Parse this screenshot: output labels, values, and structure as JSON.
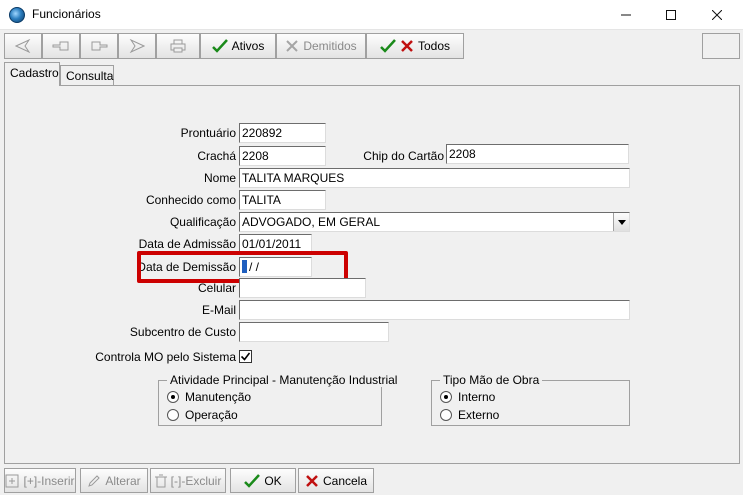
{
  "window": {
    "title": "Funcionários",
    "minimize": "—",
    "maximize": "☐",
    "close": "✕"
  },
  "toolbar": {
    "ativos": "Ativos",
    "demitidos": "Demitidos",
    "todos": "Todos"
  },
  "tabs": {
    "cadastro": "Cadastro",
    "consulta": "Consulta"
  },
  "form": {
    "prontuario": {
      "label": "Prontuário",
      "value": "220892"
    },
    "cracha": {
      "label": "Crachá",
      "value": "2208"
    },
    "chip": {
      "label": "Chip do Cartão",
      "value": "2208"
    },
    "nome": {
      "label": "Nome",
      "value": "TALITA MARQUES"
    },
    "conhecido": {
      "label": "Conhecido como",
      "value": "TALITA"
    },
    "qualificacao": {
      "label": "Qualificação",
      "value": "ADVOGADO, EM GERAL"
    },
    "admissao": {
      "label": "Data de Admissão",
      "value": "01/01/2011"
    },
    "demissao": {
      "label": "Data de Demissão",
      "value": "/  /"
    },
    "celular": {
      "label": "Celular",
      "value": ""
    },
    "email": {
      "label": "E-Mail",
      "value": ""
    },
    "subcentro": {
      "label": "Subcentro de Custo",
      "value": ""
    },
    "controla": {
      "label": "Controla MO pelo Sistema",
      "checked": true
    }
  },
  "atividade": {
    "title": "Atividade Principal - Manutenção Industrial",
    "options": [
      {
        "label": "Manutenção",
        "checked": true
      },
      {
        "label": "Operação",
        "checked": false
      }
    ]
  },
  "tipo_mao": {
    "title": "Tipo Mão de Obra",
    "options": [
      {
        "label": "Interno",
        "checked": true
      },
      {
        "label": "Externo",
        "checked": false
      }
    ]
  },
  "bottom": {
    "inserir": "[+]-Inserir",
    "alterar": "Alterar",
    "excluir": "[-]-Excluir",
    "ok": "OK",
    "cancela": "Cancela"
  },
  "colors": {
    "check_green": "#1a8a1a",
    "cancel_red": "#c01010",
    "highlight_red": "#cc0000"
  }
}
